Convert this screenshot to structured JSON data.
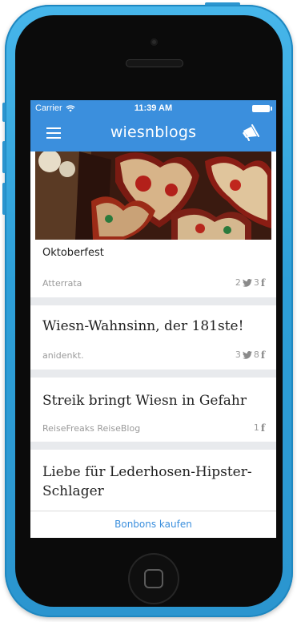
{
  "status_bar": {
    "carrier": "Carrier",
    "time": "11:39 AM",
    "wifi_icon": "wifi-icon",
    "battery_icon": "battery-icon"
  },
  "nav_bar": {
    "title": "wiesnblogs",
    "left_icon": "menu-icon",
    "right_icon": "megaphone-icon",
    "background_color": "#3b8fdd"
  },
  "feed": {
    "items": [
      {
        "title": "Oktoberfest",
        "source": "Atterrata",
        "twitter_count": "2",
        "facebook_count": "3",
        "has_image": true
      },
      {
        "title": "Wiesn-Wahnsinn, der 181ste!",
        "source": "anidenkt.",
        "twitter_count": "3",
        "facebook_count": "8"
      },
      {
        "title": "Streik bringt Wiesn in Gefahr",
        "source": "ReiseFreaks ReiseBlog",
        "twitter_count": "",
        "facebook_count": "1"
      },
      {
        "title_line1": "Liebe für Lederhosen-Hipster-",
        "title_line2": "Schlager"
      }
    ]
  },
  "bottom_bar": {
    "label": "Bonbons kaufen"
  },
  "colors": {
    "accent": "#3b8fdd",
    "phone_body": "#2d9fd8",
    "feed_background": "#e8eaed"
  }
}
